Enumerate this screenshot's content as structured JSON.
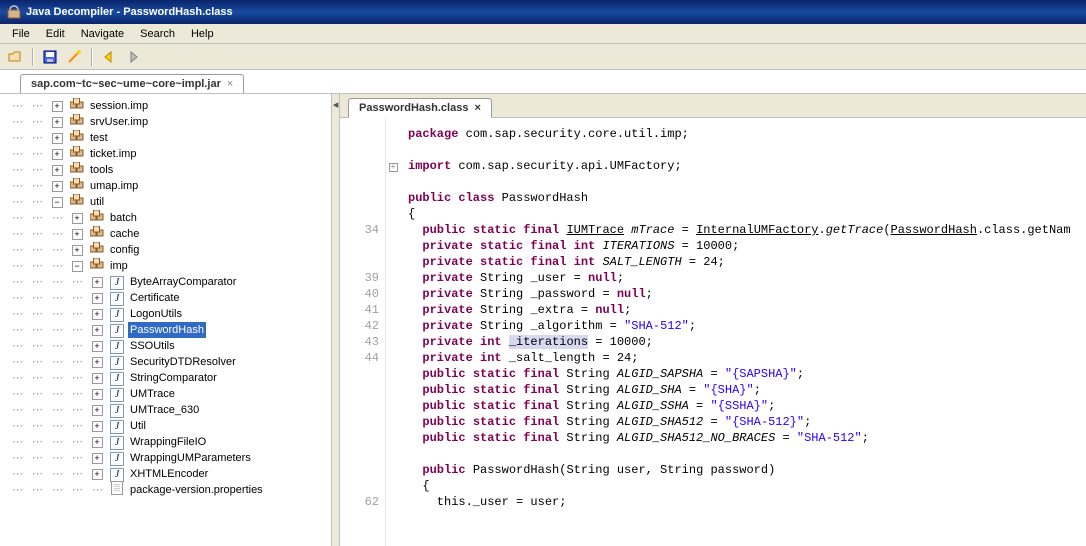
{
  "window": {
    "title": "Java Decompiler - PasswordHash.class"
  },
  "menu": {
    "file": "File",
    "edit": "Edit",
    "navigate": "Navigate",
    "search": "Search",
    "help": "Help"
  },
  "upper_tab": {
    "label": "sap.com~tc~sec~ume~core~impl.jar",
    "close": "×"
  },
  "tree": {
    "top": [
      {
        "label": "session.imp",
        "type": "pkg"
      },
      {
        "label": "srvUser.imp",
        "type": "pkg"
      },
      {
        "label": "test",
        "type": "pkg"
      },
      {
        "label": "ticket.imp",
        "type": "pkg"
      },
      {
        "label": "tools",
        "type": "pkg"
      },
      {
        "label": "umap.imp",
        "type": "pkg"
      }
    ],
    "util": {
      "label": "util",
      "type": "pkg"
    },
    "util_children_pkg": [
      {
        "label": "batch"
      },
      {
        "label": "cache"
      },
      {
        "label": "config"
      }
    ],
    "imp": {
      "label": "imp"
    },
    "imp_children": [
      {
        "label": "ByteArrayComparator"
      },
      {
        "label": "Certificate"
      },
      {
        "label": "LogonUtils"
      },
      {
        "label": "PasswordHash",
        "selected": true
      },
      {
        "label": "SSOUtils"
      },
      {
        "label": "SecurityDTDResolver"
      },
      {
        "label": "StringComparator"
      },
      {
        "label": "UMTrace"
      },
      {
        "label": "UMTrace_630"
      },
      {
        "label": "Util"
      },
      {
        "label": "WrappingFileIO"
      },
      {
        "label": "WrappingUMParameters"
      },
      {
        "label": "XHTMLEncoder"
      }
    ],
    "props": {
      "label": "package-version.properties"
    }
  },
  "editor": {
    "tab": {
      "label": "PasswordHash.class",
      "close": "×"
    },
    "gutter": [
      "",
      "",
      "",
      "",
      "",
      "",
      "34",
      "",
      "",
      "39",
      "40",
      "41",
      "42",
      "43",
      "44",
      "",
      "",
      "",
      "",
      "",
      "",
      "",
      "",
      "62"
    ],
    "code": {
      "pkg": {
        "kw": "package",
        "name": "com.sap.security.core.util.imp;"
      },
      "imp": {
        "kw": "import",
        "name": "com.sap.security.api.UMFactory;"
      },
      "clsdecl": {
        "mod": "public class",
        "name": "PasswordHash"
      },
      "l_brace": "{",
      "mtrace": {
        "mod": "public static final",
        "type": "IUMTrace",
        "var": "mTrace",
        "eq": "=",
        "rhs1": "InternalUMFactory",
        "m": "getTrace",
        "arg": "PasswordHash",
        "suffix": ".class.getNam"
      },
      "iter_c": {
        "mod": "private static final int",
        "var": "ITERATIONS",
        "val": "10000"
      },
      "salt_c": {
        "mod": "private static final int",
        "var": "SALT_LENGTH",
        "val": "24"
      },
      "user": {
        "mod": "private",
        "type": "String",
        "var": "_user",
        "val": "null"
      },
      "pass": {
        "mod": "private",
        "type": "String",
        "var": "_password",
        "val": "null"
      },
      "extra": {
        "mod": "private",
        "type": "String",
        "var": "_extra",
        "val": "null"
      },
      "algo": {
        "mod": "private",
        "type": "String",
        "var": "_algorithm",
        "val": "\"SHA-512\""
      },
      "iterf": {
        "mod": "private int",
        "var": "_iterations",
        "val": "10000"
      },
      "saltf": {
        "mod": "private int",
        "var": "_salt_length",
        "val": "24"
      },
      "a1": {
        "mod": "public static final",
        "type": "String",
        "var": "ALGID_SAPSHA",
        "val": "\"{SAPSHA}\""
      },
      "a2": {
        "mod": "public static final",
        "type": "String",
        "var": "ALGID_SHA",
        "val": "\"{SHA}\""
      },
      "a3": {
        "mod": "public static final",
        "type": "String",
        "var": "ALGID_SSHA",
        "val": "\"{SSHA}\""
      },
      "a4": {
        "mod": "public static final",
        "type": "String",
        "var": "ALGID_SHA512",
        "val": "\"{SHA-512}\""
      },
      "a5": {
        "mod": "public static final",
        "type": "String",
        "var": "ALGID_SHA512_NO_BRACES",
        "val": "\"SHA-512\""
      },
      "ctor": {
        "mod": "public",
        "name": "PasswordHash",
        "args": "(String user, String password)"
      },
      "ctor_brace": "{",
      "ctor_body": "this._user = user;"
    }
  }
}
